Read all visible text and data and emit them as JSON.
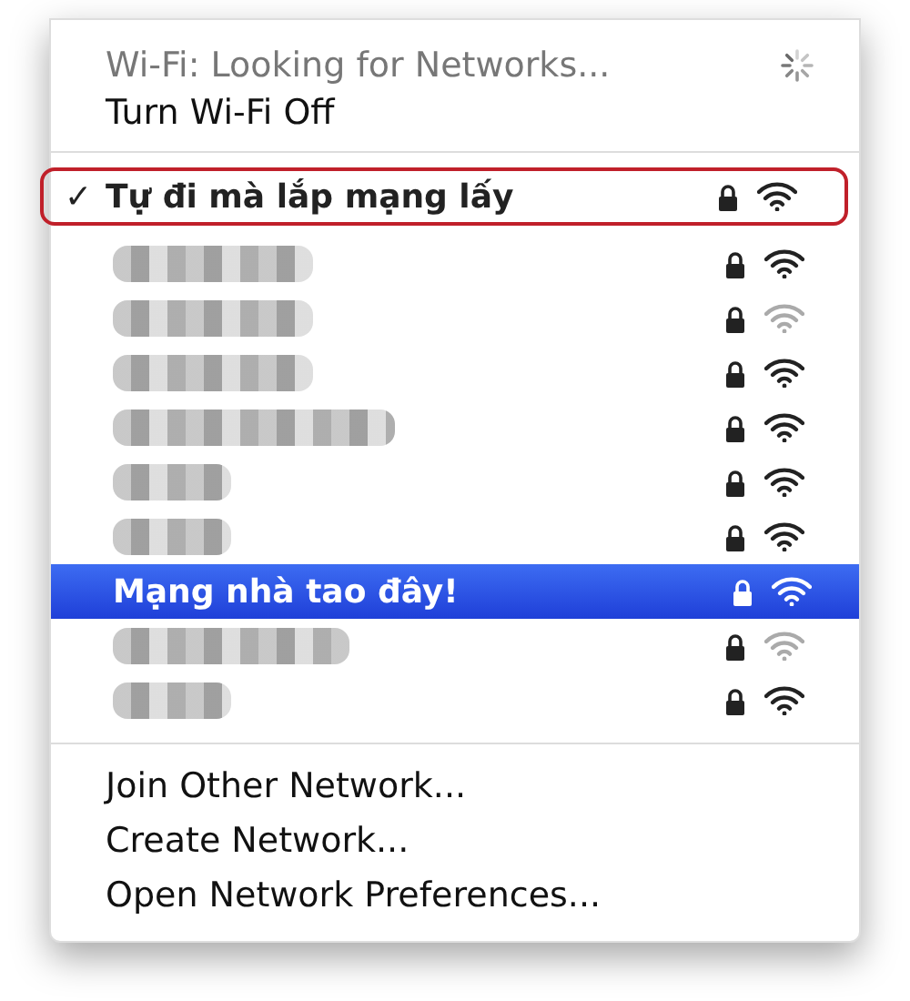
{
  "status": {
    "label": "Wi-Fi: Looking for Networks..."
  },
  "toggle": {
    "label": "Turn Wi-Fi Off"
  },
  "networks": [
    {
      "kind": "named",
      "name": "Tự đi mà lắp mạng lấy",
      "checked": true,
      "check": "✓",
      "selected": false,
      "circled": true,
      "locked": true,
      "weak": false
    },
    {
      "kind": "redacted",
      "checked": false,
      "selected": false,
      "circled": false,
      "locked": true,
      "weak": false
    },
    {
      "kind": "redacted",
      "checked": false,
      "selected": false,
      "circled": false,
      "locked": true,
      "weak": true
    },
    {
      "kind": "redacted",
      "checked": false,
      "selected": false,
      "circled": false,
      "locked": true,
      "weak": false
    },
    {
      "kind": "redacted",
      "checked": false,
      "selected": false,
      "circled": false,
      "locked": true,
      "weak": false
    },
    {
      "kind": "redacted",
      "checked": false,
      "selected": false,
      "circled": false,
      "locked": true,
      "weak": false
    },
    {
      "kind": "redacted",
      "checked": false,
      "selected": false,
      "circled": false,
      "locked": true,
      "weak": false
    },
    {
      "kind": "named",
      "name": "Mạng nhà tao đây!",
      "checked": false,
      "selected": true,
      "circled": false,
      "locked": true,
      "weak": false
    },
    {
      "kind": "redacted",
      "checked": false,
      "selected": false,
      "circled": false,
      "locked": true,
      "weak": true
    },
    {
      "kind": "redacted",
      "checked": false,
      "selected": false,
      "circled": false,
      "locked": true,
      "weak": false
    }
  ],
  "actions": [
    "Join Other Network...",
    "Create Network...",
    "Open Network Preferences..."
  ]
}
